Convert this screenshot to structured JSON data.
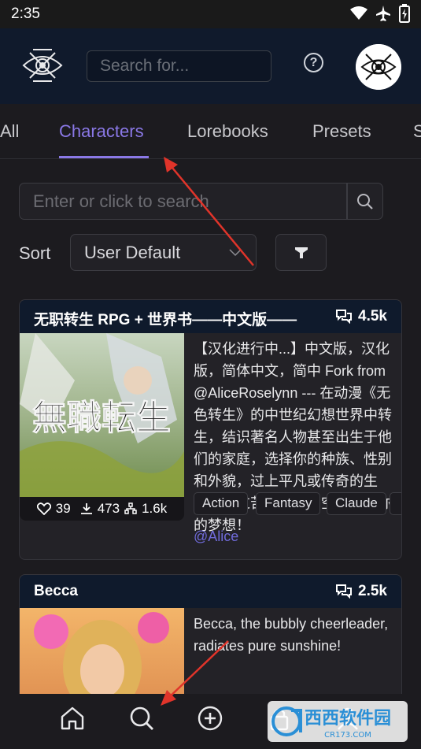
{
  "status": {
    "time": "2:35"
  },
  "header": {
    "search_placeholder": "Search for...",
    "help": "?"
  },
  "tabs": [
    {
      "label": "All",
      "active": false
    },
    {
      "label": "Characters",
      "active": true
    },
    {
      "label": "Lorebooks",
      "active": false
    },
    {
      "label": "Presets",
      "active": false
    },
    {
      "label": "S",
      "active": false
    }
  ],
  "search": {
    "placeholder": "Enter or click to search"
  },
  "sort": {
    "label": "Sort",
    "value": "User Default"
  },
  "cards": [
    {
      "title": "无职转生 RPG + 世界书——中文版——",
      "count": "4.5k",
      "description": "【汉化进行中...】中文版，汉化版，简体中文，简中 Fork from @AliceRoselynn --- 在动漫《无色转生》的中世纪幻想世界中转生，结识著名人物甚至出生于他们的家庭，选择你的种族、性别和外貌，过上平凡或传奇的生活，通过苦难到达星空，实现你的梦想！",
      "likes": "39",
      "downloads": "473",
      "tokens": "1.6k",
      "tags": [
        "Action",
        "Fantasy",
        "Claude"
      ],
      "author": "@Alice",
      "image_text": "無職転生"
    },
    {
      "title": "Becca",
      "count": "2.5k",
      "description": "Becca, the bubbly cheerleader, radiates pure sunshine!"
    }
  ],
  "nav": [
    "home-icon",
    "search-icon",
    "add-icon",
    "lock-icon",
    "profile-icon"
  ],
  "watermark": {
    "text": "西西软件园",
    "sub": "CR173.COM"
  },
  "colors": {
    "accent": "#8a78e6",
    "header_bg": "#101a2c",
    "card_head_bg": "#0f1a2c",
    "annotation": "#e0342a"
  }
}
